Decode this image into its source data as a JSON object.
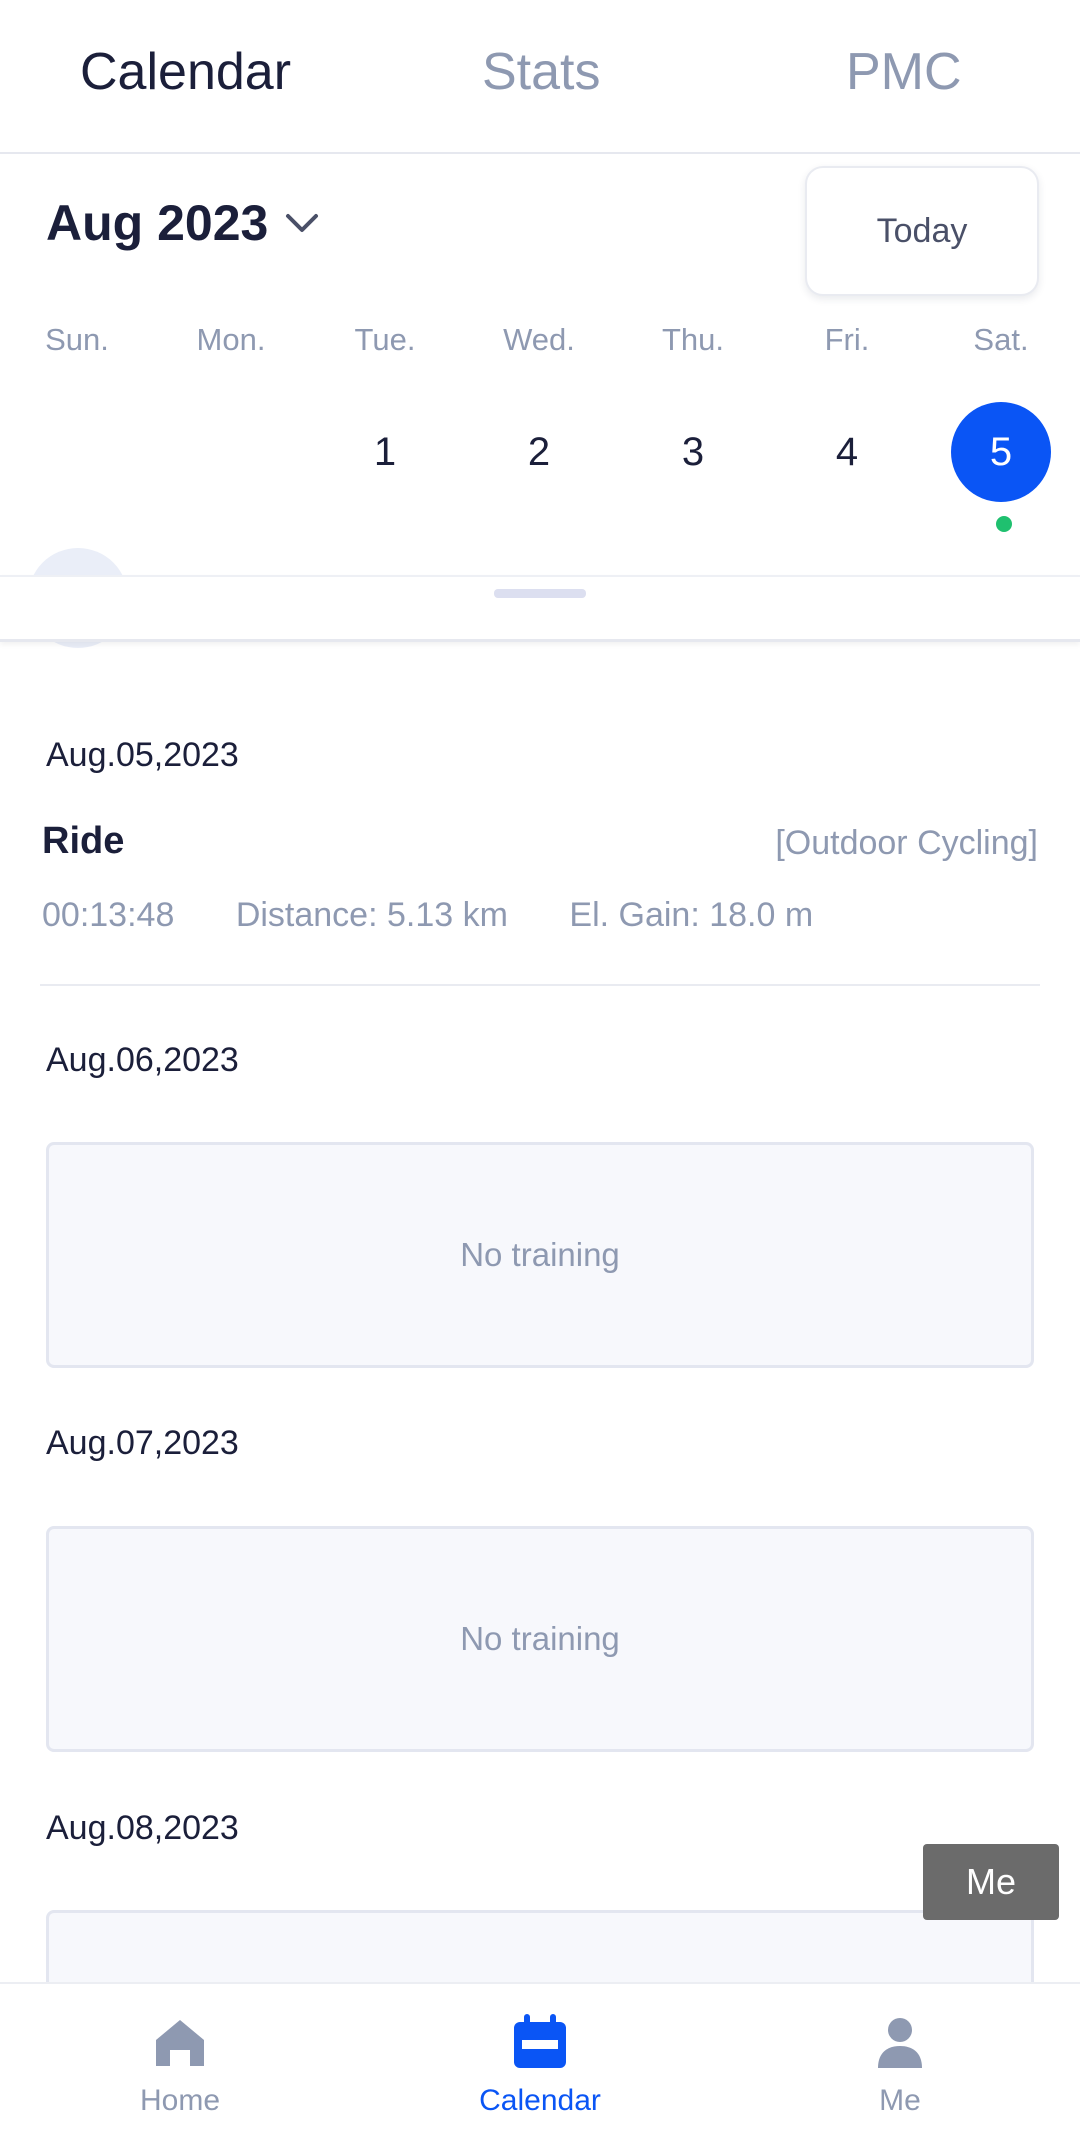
{
  "top_tabs": {
    "calendar": "Calendar",
    "stats": "Stats",
    "pmc": "PMC"
  },
  "month": {
    "label": "Aug 2023",
    "today_button": "Today"
  },
  "weekdays": [
    "Sun.",
    "Mon.",
    "Tue.",
    "Wed.",
    "Thu.",
    "Fri.",
    "Sat."
  ],
  "days": [
    "1",
    "2",
    "3",
    "4",
    "5"
  ],
  "selected_day": "5",
  "colors": {
    "accent": "#0a55f5",
    "activity_dot": "#1fc06f",
    "muted_text": "#8e99b1"
  },
  "entries": {
    "d1": {
      "date": "Aug.05,2023",
      "activity": {
        "name": "Ride",
        "type": "[Outdoor Cycling]",
        "duration": "00:13:48",
        "distance": "Distance: 5.13 km",
        "elevation": "El. Gain: 18.0 m"
      }
    },
    "d2": {
      "date": "Aug.06,2023",
      "empty_text": "No training"
    },
    "d3": {
      "date": "Aug.07,2023",
      "empty_text": "No training"
    },
    "d4": {
      "date": "Aug.08,2023"
    }
  },
  "tooltip": "Me",
  "bottom_nav": {
    "home": "Home",
    "calendar": "Calendar",
    "me": "Me"
  },
  "icons": {
    "chevron": "chevron-down-icon",
    "home": "home-icon",
    "calendar": "calendar-icon",
    "me": "user-icon"
  }
}
